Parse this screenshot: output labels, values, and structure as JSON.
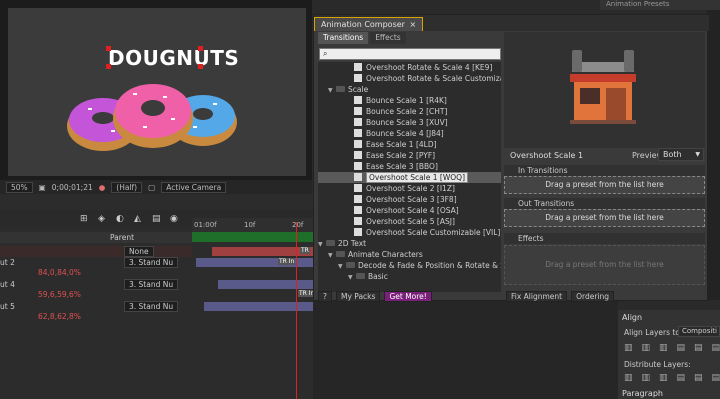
{
  "composition": {
    "title_text": "DOUGNUTS",
    "zoom": "50%",
    "timecode": "0;00;01;21",
    "resolution": "(Half)",
    "camera": "Active Camera"
  },
  "top_right_label": "Animation Presets",
  "animation_composer": {
    "window_title": "Animation Composer",
    "close": "×",
    "tabs": [
      "Transitions",
      "Effects"
    ],
    "active_tab": "Transitions",
    "search_placeholder": "",
    "tree": [
      {
        "label": "Overshoot Rotate & Scale 4 [KE9]",
        "type": "item",
        "indent": 3
      },
      {
        "label": "Overshoot Rotate & Scale Customizable",
        "type": "item",
        "indent": 3
      },
      {
        "label": "Scale",
        "type": "folder",
        "indent": 1
      },
      {
        "label": "Bounce Scale 1 [R4K]",
        "type": "item",
        "indent": 3
      },
      {
        "label": "Bounce Scale 2 [CHT]",
        "type": "item",
        "indent": 3
      },
      {
        "label": "Bounce Scale 3 [XUV]",
        "type": "item",
        "indent": 3
      },
      {
        "label": "Bounce Scale 4 [J84]",
        "type": "item",
        "indent": 3
      },
      {
        "label": "Ease Scale 1 [4LD]",
        "type": "item",
        "indent": 3
      },
      {
        "label": "Ease Scale 2 [PYF]",
        "type": "item",
        "indent": 3
      },
      {
        "label": "Ease Scale 3 [BBO]",
        "type": "item",
        "indent": 3
      },
      {
        "label": "Overshoot Scale 1 [WOQ]",
        "type": "item",
        "indent": 3,
        "selected": true
      },
      {
        "label": "Overshoot Scale 2 [I1Z]",
        "type": "item",
        "indent": 3
      },
      {
        "label": "Overshoot Scale 3 [3F8]",
        "type": "item",
        "indent": 3
      },
      {
        "label": "Overshoot Scale 4 [OSA]",
        "type": "item",
        "indent": 3
      },
      {
        "label": "Overshoot Scale 5 [ASJ]",
        "type": "item",
        "indent": 3
      },
      {
        "label": "Overshoot Scale Customizable [VIL]",
        "type": "item",
        "indent": 3
      },
      {
        "label": "2D Text",
        "type": "folder",
        "indent": 0
      },
      {
        "label": "Animate Characters",
        "type": "folder",
        "indent": 1
      },
      {
        "label": "Decode & Fade & Position & Rotate & Sc",
        "type": "folder",
        "indent": 2
      },
      {
        "label": "Basic",
        "type": "folder",
        "indent": 3
      }
    ],
    "bottom_buttons": {
      "help": "?",
      "my_packs": "My Packs",
      "get_more": "Get More!"
    },
    "preset_name": "Overshoot Scale 1",
    "preview_label": "Preview:",
    "preview_value": "Both",
    "sections": {
      "in_transitions": "In Transitions",
      "out_transitions": "Out Transitions",
      "effects": "Effects"
    },
    "drop_text": "Drag a preset from the list here",
    "footer_buttons": {
      "fix_alignment": "Fix Alignment",
      "ordering": "Ordering"
    }
  },
  "timeline": {
    "ruler": [
      "01:00f",
      "10f",
      "20f"
    ],
    "parent_header": "Parent",
    "layers": [
      {
        "name": "",
        "parent": "None",
        "prop": null
      },
      {
        "name": "ut 2",
        "parent": "3. Stand Nu",
        "prop": "84,0,84,0%"
      },
      {
        "name": "ut 4",
        "parent": "3. Stand Nu",
        "prop": "59,6,59,6%"
      },
      {
        "name": "ut 5",
        "parent": "3. Stand Nu",
        "prop": "62,8,62,8%"
      }
    ],
    "marker_label": "TR In",
    "marker_label_top": "TR"
  },
  "align_panel": {
    "tab": "Align",
    "align_layers_to": "Align Layers to:",
    "align_value": "Compositi",
    "distribute": "Distribute Layers:",
    "paragraph_tab": "Paragraph"
  },
  "colors": {
    "accent_yellow": "#d8a400",
    "get_more_purple": "#7a1f7a",
    "playhead_red": "#e02020",
    "prop_red": "#e05050"
  }
}
